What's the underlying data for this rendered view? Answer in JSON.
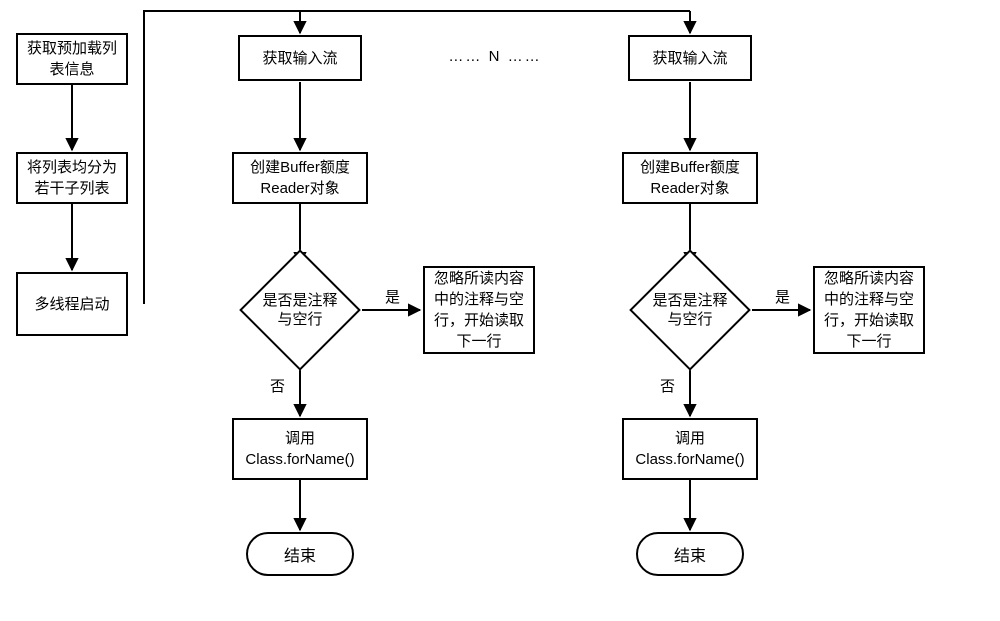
{
  "left": {
    "step1": "获取预加载列\n表信息",
    "step2": "将列表均分为\n若干子列表",
    "step3": "多线程启动"
  },
  "thread": {
    "step1": "获取输入流",
    "step2": "创建Buffer额度\nReader对象",
    "decision": "是否是注释\n与空行",
    "yes_action": "忽略所读内容\n中的注释与空\n行，开始读取\n下一行",
    "no_action": "调用\nClass.forName()",
    "end": "结束",
    "yes_label": "是",
    "no_label": "否"
  },
  "middle_label": "……  N  ……"
}
